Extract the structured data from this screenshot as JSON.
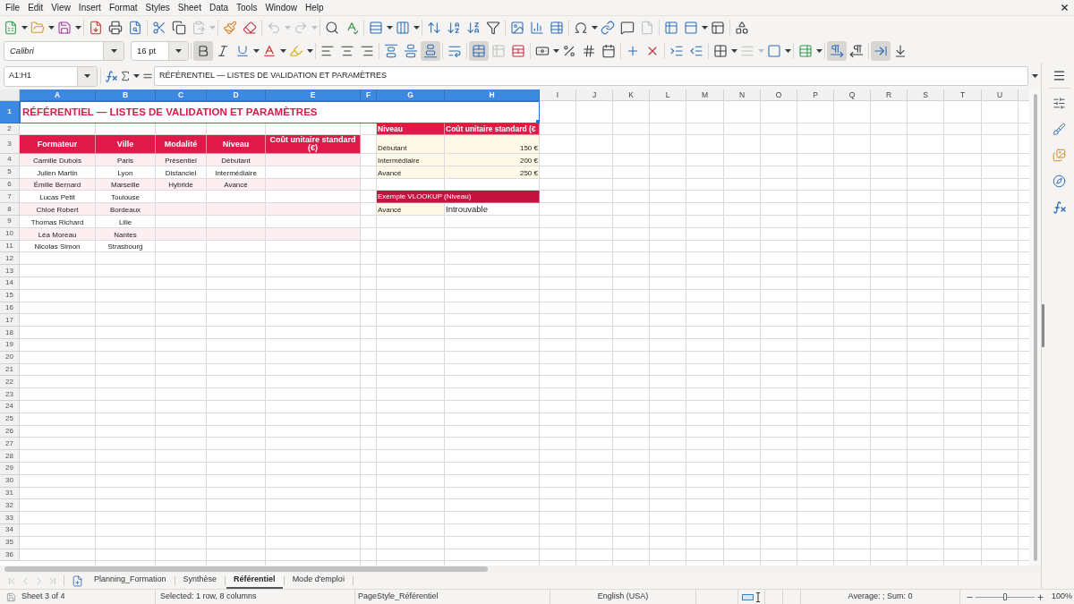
{
  "menu": [
    "File",
    "Edit",
    "View",
    "Insert",
    "Format",
    "Styles",
    "Sheet",
    "Data",
    "Tools",
    "Window",
    "Help"
  ],
  "standard_toolbar": [
    {
      "disabled": false
    },
    {
      "disabled": false
    },
    {
      "disabled": false
    },
    {
      "disabled": false
    },
    {
      "disabled": false
    },
    {
      "disabled": false
    },
    {
      "disabled": false
    },
    {
      "disabled": false
    },
    {
      "disabled": true
    },
    {
      "disabled": false
    },
    {
      "disabled": false
    },
    {
      "disabled": true
    },
    {
      "disabled": true
    },
    {
      "disabled": false
    },
    {
      "disabled": false
    },
    {
      "disabled": false
    },
    {
      "disabled": false
    },
    {
      "disabled": false
    },
    {
      "disabled": false
    },
    {
      "disabled": false
    },
    {
      "disabled": false
    },
    {
      "disabled": false
    },
    {
      "disabled": false
    },
    {
      "disabled": false
    },
    {
      "disabled": false
    },
    {
      "disabled": false
    },
    {
      "disabled": false
    },
    {
      "disabled": true
    },
    {
      "disabled": false
    },
    {
      "disabled": false
    },
    {
      "disabled": false
    },
    {
      "disabled": false
    }
  ],
  "formatting_toolbar": {
    "font_name": "Calibri",
    "font_size": "16 pt",
    "buttons": [
      {
        "pressed": true,
        "disabled": false
      },
      {
        "pressed": false,
        "disabled": false
      },
      {
        "pressed": false,
        "disabled": false
      },
      {
        "pressed": false,
        "disabled": false
      },
      {
        "pressed": false,
        "disabled": false
      },
      {
        "pressed": false,
        "disabled": false
      },
      {
        "pressed": false,
        "disabled": false
      },
      {
        "pressed": false,
        "disabled": false
      },
      {
        "pressed": false,
        "disabled": false
      },
      {
        "pressed": false,
        "disabled": false
      },
      {
        "pressed": true,
        "disabled": false
      },
      {
        "pressed": false,
        "disabled": false
      },
      {
        "pressed": true,
        "disabled": false
      },
      {
        "pressed": false,
        "disabled": true
      },
      {
        "pressed": false,
        "disabled": false
      },
      {
        "pressed": false,
        "disabled": false
      },
      {
        "pressed": false,
        "disabled": false
      },
      {
        "pressed": false,
        "disabled": false
      },
      {
        "pressed": false,
        "disabled": false
      },
      {
        "pressed": false,
        "disabled": false
      },
      {
        "pressed": false,
        "disabled": false
      },
      {
        "pressed": false,
        "disabled": false
      },
      {
        "pressed": false,
        "disabled": false
      },
      {
        "pressed": false,
        "disabled": false
      },
      {
        "pressed": false,
        "disabled": true
      },
      {
        "pressed": false,
        "disabled": false
      },
      {
        "pressed": false,
        "disabled": false
      },
      {
        "pressed": true,
        "disabled": false
      },
      {
        "pressed": false,
        "disabled": false
      },
      {
        "pressed": true,
        "disabled": false
      },
      {
        "pressed": false,
        "disabled": false
      }
    ]
  },
  "formula_bar": {
    "name_box": "A1:H1",
    "formula": "RÉFÉRENTIEL — LISTES DE VALIDATION ET PARAMÈTRES"
  },
  "sheet": {
    "columns": [
      {
        "label": "A",
        "selected": true
      },
      {
        "label": "B",
        "selected": true
      },
      {
        "label": "C",
        "selected": true
      },
      {
        "label": "D",
        "selected": true
      },
      {
        "label": "E",
        "selected": true
      },
      {
        "label": "F",
        "selected": true
      },
      {
        "label": "G",
        "selected": true
      },
      {
        "label": "H",
        "selected": true
      },
      {
        "label": "I",
        "selected": false
      },
      {
        "label": "J",
        "selected": false
      },
      {
        "label": "K",
        "selected": false
      },
      {
        "label": "L",
        "selected": false
      },
      {
        "label": "M",
        "selected": false
      },
      {
        "label": "N",
        "selected": false
      },
      {
        "label": "O",
        "selected": false
      },
      {
        "label": "P",
        "selected": false
      },
      {
        "label": "Q",
        "selected": false
      },
      {
        "label": "R",
        "selected": false
      },
      {
        "label": "S",
        "selected": false
      },
      {
        "label": "T",
        "selected": false
      },
      {
        "label": "U",
        "selected": false
      }
    ],
    "rows": [
      {
        "label": "1",
        "selected": true,
        "cells": [
          {
            "kind": "title",
            "text": "RÉFÉRENTIEL — LISTES DE VALIDATION ET PARAMÈTRES",
            "selected": true
          },
          {
            "kind": "merged"
          },
          {
            "kind": "merged"
          },
          {
            "kind": "merged"
          },
          {
            "kind": "merged"
          },
          {
            "kind": "merged"
          },
          {
            "kind": "merged"
          },
          {
            "kind": "merged"
          }
        ]
      },
      {
        "label": "2",
        "selected": false,
        "cells": [
          {
            "kind": "blank"
          },
          {
            "kind": "blank"
          },
          {
            "kind": "blank"
          },
          {
            "kind": "blank"
          },
          {
            "kind": "blank"
          },
          {
            "kind": "blank"
          },
          {
            "kind": "keyhead",
            "text": "Niveau"
          },
          {
            "kind": "keyhead",
            "text": "Coût unitaire standard (€"
          }
        ]
      },
      {
        "label": "3",
        "selected": false,
        "cells": [
          {
            "kind": "header",
            "text": "Formateur"
          },
          {
            "kind": "header",
            "text": "Ville"
          },
          {
            "kind": "header",
            "text": "Modalité"
          },
          {
            "kind": "header",
            "text": "Niveau"
          },
          {
            "kind": "header",
            "text": "Coût unitaire standard (€)"
          },
          {
            "kind": "blank"
          },
          {
            "kind": "key",
            "text": "Débutant"
          },
          {
            "kind": "amount",
            "text": "150 €"
          }
        ]
      },
      {
        "label": "4",
        "selected": false,
        "cells": [
          {
            "kind": "banded",
            "text": "Camille Dubois"
          },
          {
            "kind": "banded",
            "text": "Paris"
          },
          {
            "kind": "banded",
            "text": "Présentiel"
          },
          {
            "kind": "banded",
            "text": "Débutant"
          },
          {
            "kind": "banded"
          },
          {
            "kind": "blank"
          },
          {
            "kind": "key",
            "text": "Intermédiaire"
          },
          {
            "kind": "amount",
            "text": "200 €"
          }
        ]
      },
      {
        "label": "5",
        "selected": false,
        "cells": [
          {
            "kind": "plain",
            "text": "Julien Martin"
          },
          {
            "kind": "plain",
            "text": "Lyon"
          },
          {
            "kind": "plain",
            "text": "Distanciel"
          },
          {
            "kind": "plain",
            "text": "Intermédiaire"
          },
          {
            "kind": "blank"
          },
          {
            "kind": "blank"
          },
          {
            "kind": "key",
            "text": "Avancé"
          },
          {
            "kind": "amount",
            "text": "250 €"
          }
        ]
      },
      {
        "label": "6",
        "selected": false,
        "cells": [
          {
            "kind": "banded",
            "text": "Émilie Bernard"
          },
          {
            "kind": "banded",
            "text": "Marseille"
          },
          {
            "kind": "banded",
            "text": "Hybride"
          },
          {
            "kind": "banded",
            "text": "Avancé"
          },
          {
            "kind": "banded"
          }
        ]
      },
      {
        "label": "7",
        "selected": false,
        "cells": [
          {
            "kind": "plain",
            "text": "Lucas Petit"
          },
          {
            "kind": "plain",
            "text": "Toulouse"
          },
          {
            "kind": "blank"
          },
          {
            "kind": "blank"
          },
          {
            "kind": "blank"
          },
          {
            "kind": "blank"
          },
          {
            "kind": "section",
            "text": "Exemple VLOOKUP (Niveau)"
          },
          {
            "kind": "merged"
          }
        ]
      },
      {
        "label": "8",
        "selected": false,
        "cells": [
          {
            "kind": "banded",
            "text": "Chloé Robert"
          },
          {
            "kind": "banded",
            "text": "Bordeaux"
          },
          {
            "kind": "banded"
          },
          {
            "kind": "banded"
          },
          {
            "kind": "banded"
          },
          {
            "kind": "blank"
          },
          {
            "kind": "key",
            "text": "Avancé"
          },
          {
            "kind": "result",
            "text": "Introuvable"
          }
        ]
      },
      {
        "label": "9",
        "selected": false,
        "cells": [
          {
            "kind": "plain",
            "text": "Thomas Richard"
          },
          {
            "kind": "plain",
            "text": "Lille"
          }
        ]
      },
      {
        "label": "10",
        "selected": false,
        "cells": [
          {
            "kind": "banded",
            "text": "Léa Moreau"
          },
          {
            "kind": "banded",
            "text": "Nantes"
          },
          {
            "kind": "banded"
          },
          {
            "kind": "banded"
          },
          {
            "kind": "banded"
          }
        ]
      },
      {
        "label": "11",
        "selected": false,
        "cells": [
          {
            "kind": "plain",
            "text": "Nicolas Simon"
          },
          {
            "kind": "plain",
            "text": "Strasbourg"
          }
        ]
      },
      {
        "label": "12",
        "selected": false
      },
      {
        "label": "13",
        "selected": false
      },
      {
        "label": "14",
        "selected": false
      },
      {
        "label": "15",
        "selected": false
      },
      {
        "label": "16",
        "selected": false
      },
      {
        "label": "17",
        "selected": false
      },
      {
        "label": "18",
        "selected": false
      },
      {
        "label": "19",
        "selected": false
      },
      {
        "label": "20",
        "selected": false
      },
      {
        "label": "21",
        "selected": false
      },
      {
        "label": "22",
        "selected": false
      },
      {
        "label": "23",
        "selected": false
      },
      {
        "label": "24",
        "selected": false
      },
      {
        "label": "25",
        "selected": false
      },
      {
        "label": "26",
        "selected": false
      },
      {
        "label": "27",
        "selected": false
      },
      {
        "label": "28",
        "selected": false
      },
      {
        "label": "29",
        "selected": false
      },
      {
        "label": "30",
        "selected": false
      },
      {
        "label": "31",
        "selected": false
      },
      {
        "label": "32",
        "selected": false
      },
      {
        "label": "33",
        "selected": false
      },
      {
        "label": "34",
        "selected": false
      },
      {
        "label": "35",
        "selected": false
      },
      {
        "label": "36",
        "selected": false
      }
    ]
  },
  "sheet_tabs": {
    "nav_buttons": [
      {
        "disabled": true
      },
      {
        "disabled": true
      },
      {
        "disabled": true
      },
      {
        "disabled": true
      }
    ],
    "tabs": [
      {
        "label": "Planning_Formation",
        "selected": false
      },
      {
        "label": "Synthèse",
        "selected": false
      },
      {
        "label": "Référentiel",
        "selected": true
      },
      {
        "label": "Mode d'emploi",
        "selected": false
      }
    ]
  },
  "status_bar": {
    "sheet": "Sheet 3 of 4",
    "selection": "Selected: 1 row, 8 columns",
    "page_style": "PageStyle_Référentiel",
    "language": "English (USA)",
    "summary": "Average: ; Sum: 0",
    "zoom": {
      "level": 0.5,
      "reading": "100%"
    }
  }
}
